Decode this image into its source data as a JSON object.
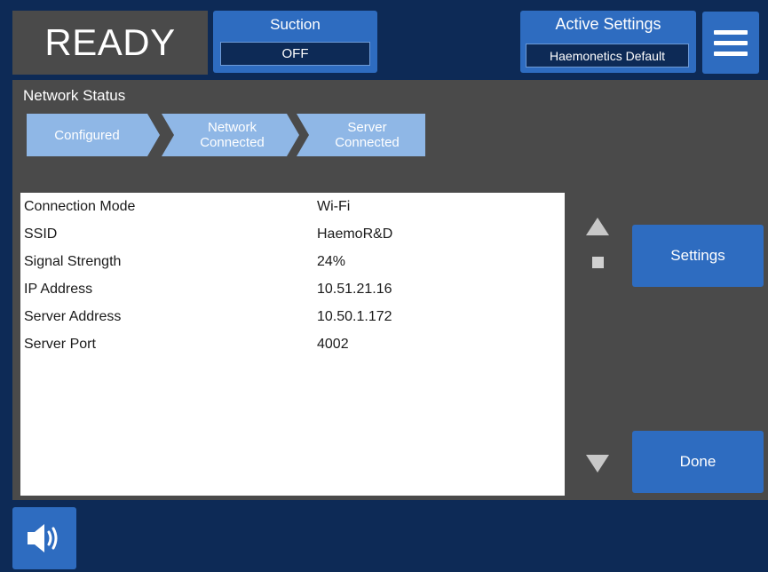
{
  "header": {
    "state": "READY",
    "suction": {
      "title": "Suction",
      "value": "OFF"
    },
    "active_settings": {
      "title": "Active Settings",
      "value": "Haemonetics Default"
    },
    "menu_icon": "hamburger-menu-icon"
  },
  "network": {
    "title": "Network Status",
    "steps": [
      {
        "label": "Configured"
      },
      {
        "label": "Network\nConnected"
      },
      {
        "label": "Server\nConnected"
      }
    ],
    "rows": [
      {
        "label": "Connection Mode",
        "value": "Wi-Fi"
      },
      {
        "label": "SSID",
        "value": "HaemoR&D"
      },
      {
        "label": "Signal Strength",
        "value": "24%"
      },
      {
        "label": "IP Address",
        "value": "10.51.21.16"
      },
      {
        "label": "Server Address",
        "value": "10.50.1.172"
      },
      {
        "label": "Server Port",
        "value": "4002"
      }
    ]
  },
  "buttons": {
    "settings": "Settings",
    "done": "Done"
  },
  "icons": {
    "scroll_up": "triangle-up-icon",
    "scroll_thumb": "square-icon",
    "scroll_down": "triangle-down-icon",
    "sound": "speaker-icon"
  },
  "colors": {
    "accent": "#2e6cc0",
    "background": "#0d2a56",
    "panel": "#4a4a4a",
    "step": "#8fb7e6"
  }
}
